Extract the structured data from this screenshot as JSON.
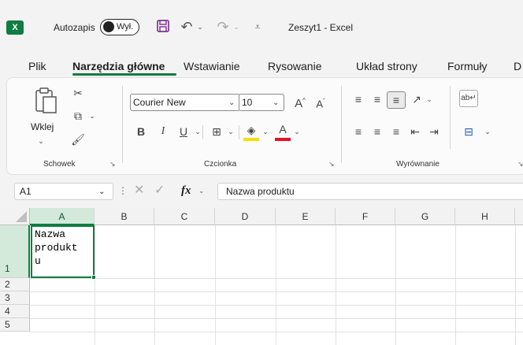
{
  "titlebar": {
    "app_icon": "X",
    "autosave_label": "Autozapis",
    "toggle_state": "Wył.",
    "doc_title": "Zeszyt1 - Excel",
    "icons": [
      "save-icon",
      "undo-icon",
      "redo-icon",
      "customize-qat-icon"
    ]
  },
  "menu": {
    "items": [
      "Plik",
      "Narzędzia główne",
      "Wstawianie",
      "Rysowanie",
      "Układ strony",
      "Formuły",
      "D"
    ],
    "active": "Narzędzia główne"
  },
  "ribbon": {
    "clipboard": {
      "label": "Schowek",
      "paste": "Wklej"
    },
    "font": {
      "label": "Czcionka",
      "font_name": "Courier New",
      "font_size": "10",
      "bold": "B",
      "italic": "I",
      "underline": "U",
      "fill_color": "#f5e100",
      "font_color": "#e81123"
    },
    "alignment": {
      "label": "Wyrównanie"
    }
  },
  "formula_bar": {
    "name_box": "A1",
    "fx": "fx",
    "content": "Nazwa produktu"
  },
  "grid": {
    "columns": [
      "A",
      "B",
      "C",
      "D",
      "E",
      "F",
      "G",
      "H"
    ],
    "rows": [
      "1",
      "2",
      "3",
      "4",
      "5"
    ],
    "active_cell": "A1",
    "a1_lines": [
      "Nazwa",
      "produkt",
      "u"
    ],
    "accent": "#107c41"
  }
}
